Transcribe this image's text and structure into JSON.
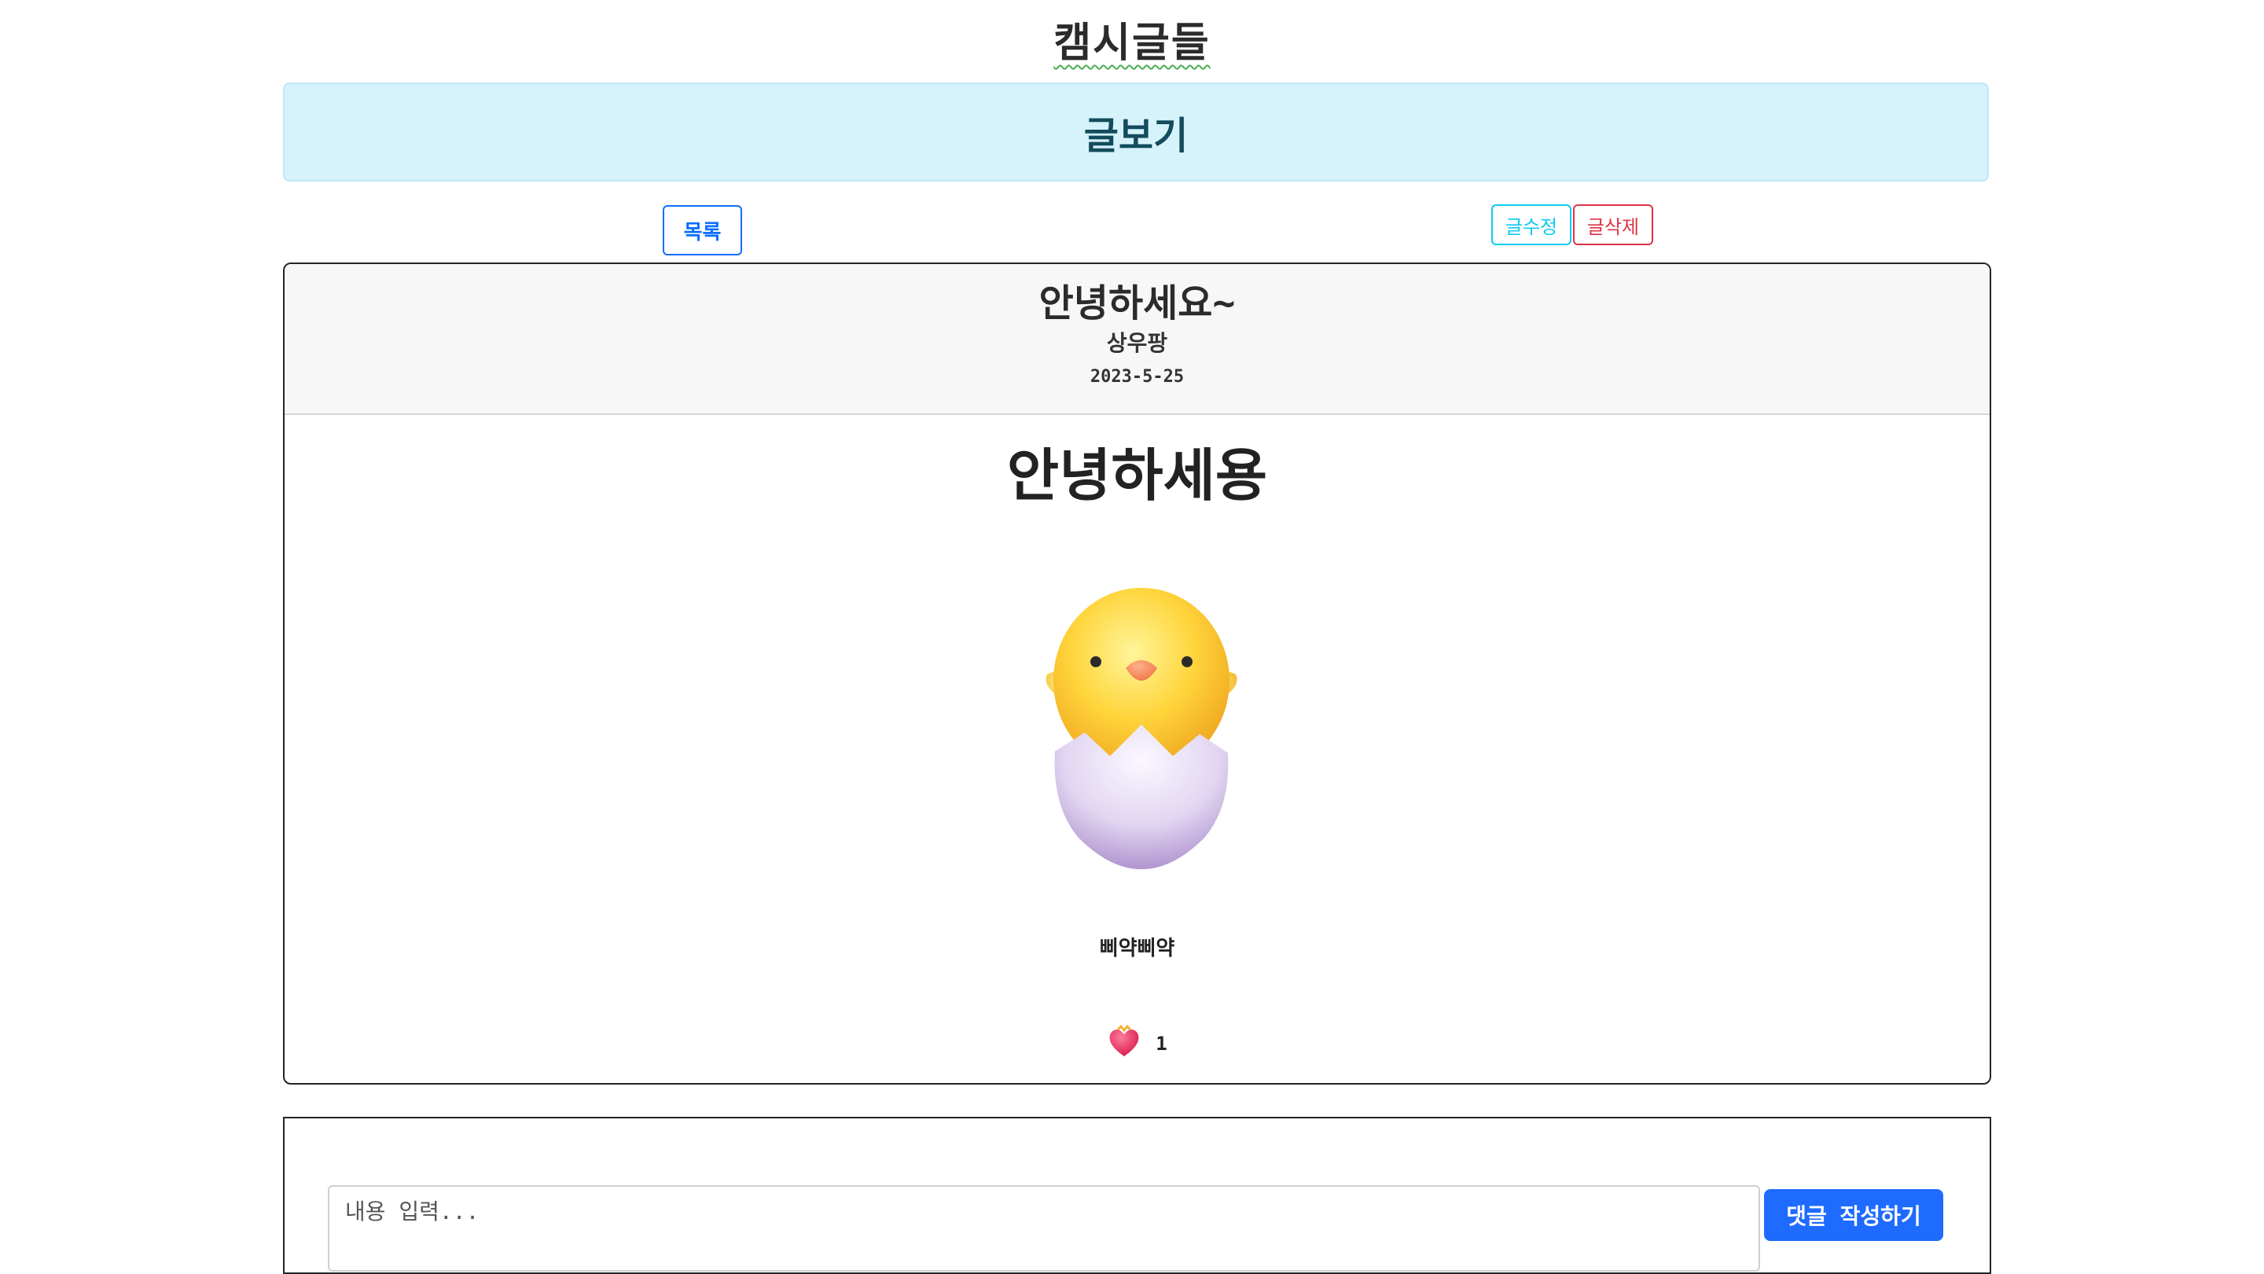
{
  "header": {
    "site_title": "캠시글들",
    "page_banner": "글보기"
  },
  "actions": {
    "list_label": "목록",
    "edit_label": "글수정",
    "delete_label": "글삭제"
  },
  "post": {
    "title": "안녕하세요~",
    "author": "상우팡",
    "date": "2023-5-25",
    "content_heading": "안녕하세용",
    "image_icon": "hatching-chick",
    "caption": "삐약삐약",
    "like_icon": "heart-icon",
    "like_count": "1"
  },
  "comments": {
    "input_placeholder": "내용 입력...",
    "submit_label": "댓글 작성하기"
  },
  "colors": {
    "banner_bg": "#d6f2fa",
    "primary": "#0d6efd",
    "info": "#0dcaf0",
    "danger": "#dc3545",
    "comment_button": "#1f6bff"
  }
}
